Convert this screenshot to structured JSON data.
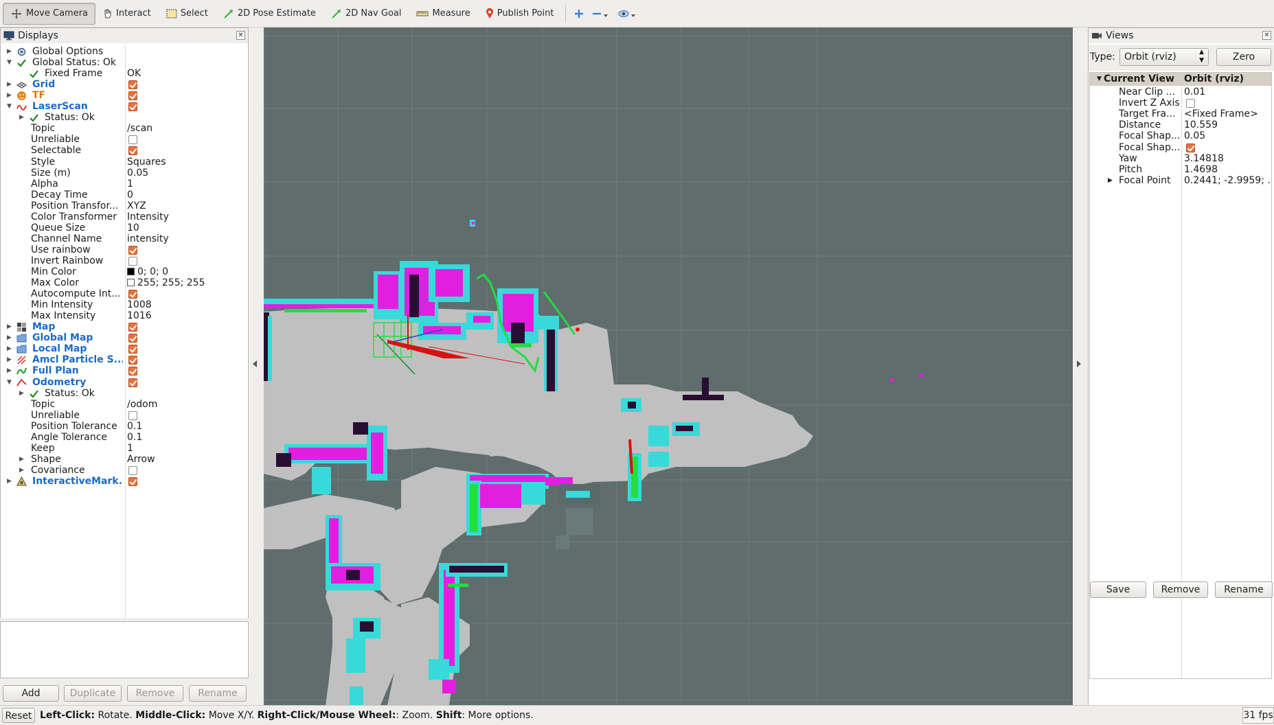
{
  "toolbar": {
    "tools": [
      {
        "label": "Move Camera",
        "icon": "move-camera-icon",
        "active": true
      },
      {
        "label": "Interact",
        "icon": "hand-icon",
        "active": false
      },
      {
        "label": "Select",
        "icon": "select-icon",
        "active": false
      },
      {
        "label": "2D Pose Estimate",
        "icon": "pose-arrow-icon",
        "active": false
      },
      {
        "label": "2D Nav Goal",
        "icon": "nav-goal-arrow-icon",
        "active": false
      },
      {
        "label": "Measure",
        "icon": "ruler-icon",
        "active": false
      },
      {
        "label": "Publish Point",
        "icon": "map-pin-icon",
        "active": false
      }
    ]
  },
  "displays": {
    "title": "Displays",
    "rows": [
      {
        "indent": 0,
        "arrow": "right",
        "icon": "gear",
        "label": "Global Options",
        "style": "normal",
        "value": ""
      },
      {
        "indent": 0,
        "arrow": "down",
        "icon": "check",
        "label": "Global Status: Ok",
        "style": "normal",
        "value": ""
      },
      {
        "indent": 1,
        "arrow": "",
        "icon": "check",
        "label": "Fixed Frame",
        "style": "normal",
        "value": "OK"
      },
      {
        "indent": 0,
        "arrow": "right",
        "icon": "grid",
        "label": "Grid",
        "style": "blue",
        "checkbox": true
      },
      {
        "indent": 0,
        "arrow": "right",
        "icon": "tf",
        "label": "TF",
        "style": "orange",
        "checkbox": true
      },
      {
        "indent": 0,
        "arrow": "down",
        "icon": "laser",
        "label": "LaserScan",
        "style": "blue",
        "checkbox": true
      },
      {
        "indent": 1,
        "arrow": "right",
        "icon": "check",
        "label": "Status: Ok",
        "style": "normal",
        "value": ""
      },
      {
        "indent": 1,
        "arrow": "",
        "icon": "",
        "label": "Topic",
        "style": "normal",
        "value": "/scan"
      },
      {
        "indent": 1,
        "arrow": "",
        "icon": "",
        "label": "Unreliable",
        "style": "normal",
        "checkbox": false
      },
      {
        "indent": 1,
        "arrow": "",
        "icon": "",
        "label": "Selectable",
        "style": "normal",
        "checkbox": true
      },
      {
        "indent": 1,
        "arrow": "",
        "icon": "",
        "label": "Style",
        "style": "normal",
        "value": "Squares"
      },
      {
        "indent": 1,
        "arrow": "",
        "icon": "",
        "label": "Size (m)",
        "style": "normal",
        "value": "0.05"
      },
      {
        "indent": 1,
        "arrow": "",
        "icon": "",
        "label": "Alpha",
        "style": "normal",
        "value": "1"
      },
      {
        "indent": 1,
        "arrow": "",
        "icon": "",
        "label": "Decay Time",
        "style": "normal",
        "value": "0"
      },
      {
        "indent": 1,
        "arrow": "",
        "icon": "",
        "label": "Position Transfor...",
        "style": "normal",
        "value": "XYZ"
      },
      {
        "indent": 1,
        "arrow": "",
        "icon": "",
        "label": "Color Transformer",
        "style": "normal",
        "value": "Intensity"
      },
      {
        "indent": 1,
        "arrow": "",
        "icon": "",
        "label": "Queue Size",
        "style": "normal",
        "value": "10"
      },
      {
        "indent": 1,
        "arrow": "",
        "icon": "",
        "label": "Channel Name",
        "style": "normal",
        "value": "intensity"
      },
      {
        "indent": 1,
        "arrow": "",
        "icon": "",
        "label": "Use rainbow",
        "style": "normal",
        "checkbox": true
      },
      {
        "indent": 1,
        "arrow": "",
        "icon": "",
        "label": "Invert Rainbow",
        "style": "normal",
        "checkbox": false
      },
      {
        "indent": 1,
        "arrow": "",
        "icon": "",
        "label": "Min Color",
        "style": "normal",
        "value": "0; 0; 0",
        "swatch": "#000000"
      },
      {
        "indent": 1,
        "arrow": "",
        "icon": "",
        "label": "Max Color",
        "style": "normal",
        "value": "255; 255; 255",
        "swatch": "#ffffff"
      },
      {
        "indent": 1,
        "arrow": "",
        "icon": "",
        "label": "Autocompute Int...",
        "style": "normal",
        "checkbox": true
      },
      {
        "indent": 1,
        "arrow": "",
        "icon": "",
        "label": "Min Intensity",
        "style": "normal",
        "value": "1008"
      },
      {
        "indent": 1,
        "arrow": "",
        "icon": "",
        "label": "Max Intensity",
        "style": "normal",
        "value": "1016"
      },
      {
        "indent": 0,
        "arrow": "right",
        "icon": "map",
        "label": "Map",
        "style": "blue",
        "checkbox": true
      },
      {
        "indent": 0,
        "arrow": "right",
        "icon": "folder",
        "label": "Global Map",
        "style": "blue",
        "checkbox": true
      },
      {
        "indent": 0,
        "arrow": "right",
        "icon": "folder",
        "label": "Local Map",
        "style": "blue",
        "checkbox": true
      },
      {
        "indent": 0,
        "arrow": "right",
        "icon": "particles",
        "label": "Amcl Particle S...",
        "style": "blue",
        "checkbox": true
      },
      {
        "indent": 0,
        "arrow": "right",
        "icon": "path",
        "label": "Full Plan",
        "style": "blue",
        "checkbox": true
      },
      {
        "indent": 0,
        "arrow": "down",
        "icon": "odometry",
        "label": "Odometry",
        "style": "blue",
        "checkbox": true
      },
      {
        "indent": 1,
        "arrow": "right",
        "icon": "check",
        "label": "Status: Ok",
        "style": "normal",
        "value": ""
      },
      {
        "indent": 1,
        "arrow": "",
        "icon": "",
        "label": "Topic",
        "style": "normal",
        "value": "/odom"
      },
      {
        "indent": 1,
        "arrow": "",
        "icon": "",
        "label": "Unreliable",
        "style": "normal",
        "checkbox": false
      },
      {
        "indent": 1,
        "arrow": "",
        "icon": "",
        "label": "Position Tolerance",
        "style": "normal",
        "value": "0.1"
      },
      {
        "indent": 1,
        "arrow": "",
        "icon": "",
        "label": "Angle Tolerance",
        "style": "normal",
        "value": "0.1"
      },
      {
        "indent": 1,
        "arrow": "",
        "icon": "",
        "label": "Keep",
        "style": "normal",
        "value": "1"
      },
      {
        "indent": 1,
        "arrow": "right",
        "icon": "",
        "label": "Shape",
        "style": "normal",
        "value": "Arrow"
      },
      {
        "indent": 1,
        "arrow": "right",
        "icon": "",
        "label": "Covariance",
        "style": "normal",
        "checkbox": false
      },
      {
        "indent": 0,
        "arrow": "right",
        "icon": "interactive",
        "label": "InteractiveMark...",
        "style": "blue",
        "checkbox": true
      }
    ],
    "buttons": {
      "add": "Add",
      "duplicate": "Duplicate",
      "remove": "Remove",
      "rename": "Rename"
    }
  },
  "views": {
    "title": "Views",
    "type_label": "Type:",
    "type_value": "Orbit (rviz)",
    "zero_label": "Zero",
    "header_label": "Current View",
    "header_value": "Orbit (rviz)",
    "rows": [
      {
        "label": "Near Clip ...",
        "value": "0.01"
      },
      {
        "label": "Invert Z Axis",
        "checkbox": false
      },
      {
        "label": "Target Fra...",
        "value": "<Fixed Frame>"
      },
      {
        "label": "Distance",
        "value": "10.559"
      },
      {
        "label": "Focal Shap...",
        "value": "0.05"
      },
      {
        "label": "Focal Shap...",
        "checkbox": true
      },
      {
        "label": "Yaw",
        "value": "3.14818"
      },
      {
        "label": "Pitch",
        "value": "1.4698"
      },
      {
        "label": "Focal Point",
        "value": "0.2441; -2.9959; ...",
        "arrow": "right"
      }
    ],
    "buttons": {
      "save": "Save",
      "remove": "Remove",
      "rename": "Rename"
    }
  },
  "status": {
    "reset": "Reset",
    "segments": [
      {
        "bold": "Left-Click:",
        "text": " Rotate. "
      },
      {
        "bold": "Middle-Click:",
        "text": " Move X/Y. "
      },
      {
        "bold": "Right-Click/Mouse Wheel:",
        "text": ": Zoom. "
      },
      {
        "bold": "Shift",
        "text": ": More options."
      }
    ],
    "fps": "31 fps"
  },
  "colors": {
    "viewport_bg": "#5f6d6c",
    "free_space": "#c0c0c0",
    "obstacle": "#2a0d32",
    "inflation_cyan": "#38d9d9",
    "inflation_magenta": "#e21fe0",
    "plan_green": "#22dd44",
    "pose_red": "#e01010",
    "accent_checkbox": "#e8733d",
    "display_name_blue": "#1b6ac9"
  }
}
